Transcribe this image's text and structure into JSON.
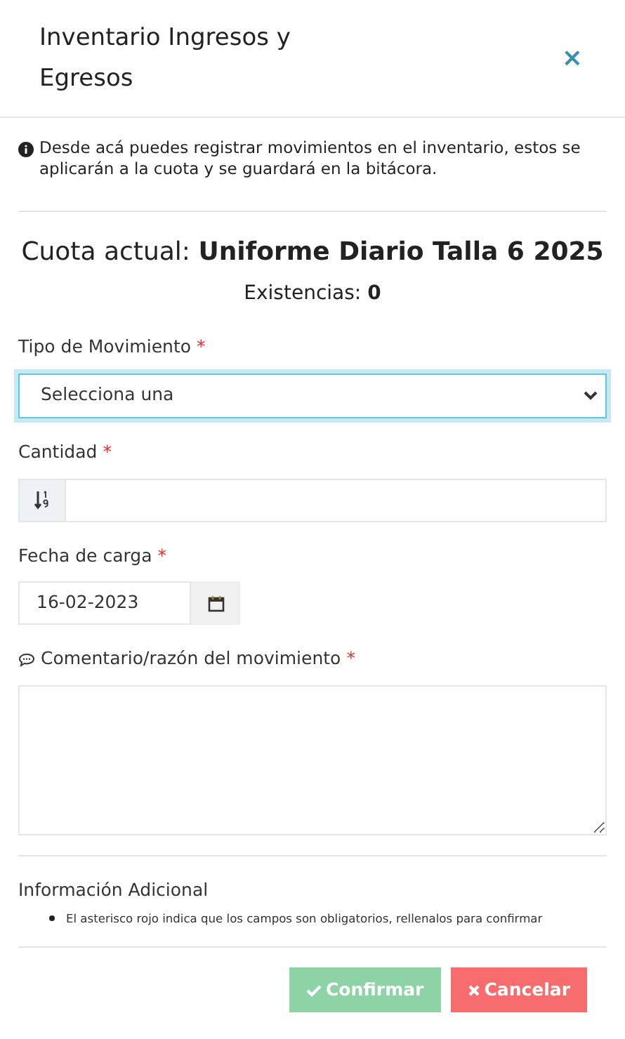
{
  "modal": {
    "title": "Inventario Ingresos y Egresos",
    "close": "×"
  },
  "notice": "Desde acá puedes registrar movimientos en el inventario, estos se aplicarán a la cuota y se guardará en la bitácora.",
  "quota": {
    "label": "Cuota actual:",
    "value": "Uniforme Diario Talla 6 2025",
    "stock_label": "Existencias:",
    "stock_value": "0"
  },
  "fields": [
    {
      "kind": "select",
      "label": "Tipo de Movimiento",
      "mark": "*",
      "value": "Selecciona una",
      "focused": true
    },
    {
      "kind": "number",
      "label": "Cantidad",
      "mark": "*"
    },
    {
      "kind": "date",
      "label": "Fecha de carga",
      "mark": "*",
      "value": "16-02-2023"
    },
    {
      "kind": "textarea",
      "label": "Comentario/razón del movimiento",
      "mark": "*"
    }
  ],
  "additional_info": {
    "title": "Información Adicional",
    "items": [
      "El asterisco rojo indica que los campos son obligatorios, rellenalos para confirmar"
    ]
  },
  "buttons": [
    {
      "kind": "confirm",
      "label": "Confirmar"
    },
    {
      "kind": "cancel",
      "label": "Cancelar"
    }
  ]
}
